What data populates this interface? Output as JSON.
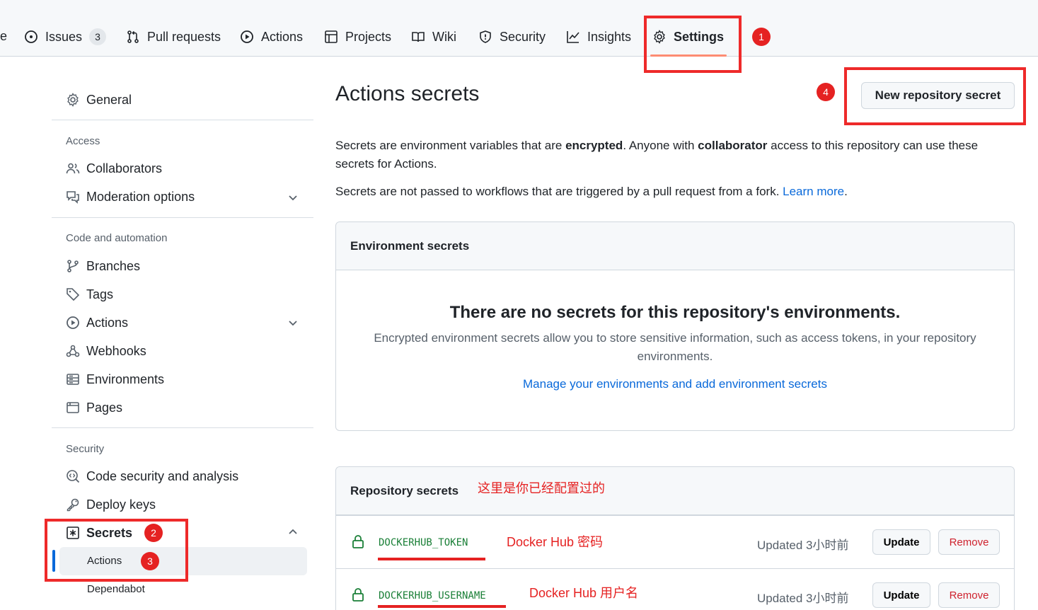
{
  "nav": {
    "truncated_left": "e",
    "tabs": [
      {
        "label": "Issues",
        "count": "3"
      },
      {
        "label": "Pull requests"
      },
      {
        "label": "Actions"
      },
      {
        "label": "Projects"
      },
      {
        "label": "Wiki"
      },
      {
        "label": "Security"
      },
      {
        "label": "Insights"
      },
      {
        "label": "Settings"
      }
    ]
  },
  "annotations": {
    "badges": [
      "1",
      "2",
      "3",
      "4"
    ],
    "notes": [
      "这里是你已经配置过的",
      "Docker Hub 密码",
      "Docker Hub 用户名"
    ]
  },
  "sidebar": {
    "general": "General",
    "sections": [
      {
        "heading": "Access",
        "items": [
          "Collaborators",
          "Moderation options"
        ]
      },
      {
        "heading": "Code and automation",
        "items": [
          "Branches",
          "Tags",
          "Actions",
          "Webhooks",
          "Environments",
          "Pages"
        ]
      },
      {
        "heading": "Security",
        "items": [
          "Code security and analysis",
          "Deploy keys",
          "Secrets"
        ]
      }
    ],
    "secrets_sub": [
      "Actions",
      "Dependabot"
    ]
  },
  "main": {
    "title": "Actions secrets",
    "new_secret_button": "New repository secret",
    "para1": {
      "a": "Secrets are environment variables that are ",
      "b": "encrypted",
      "c": ". Anyone with ",
      "d": "collaborator",
      "e": " access to this repository can use these secrets for Actions."
    },
    "para2": {
      "text": "Secrets are not passed to workflows that are triggered by a pull request from a fork. ",
      "link": "Learn more"
    },
    "env_box": {
      "header": "Environment secrets",
      "blank_title": "There are no secrets for this repository's environments.",
      "blank_desc": "Encrypted environment secrets allow you to store sensitive information, such as access tokens, in your repository environments.",
      "manage_link": "Manage your environments and add environment secrets"
    },
    "repo_box": {
      "header": "Repository secrets",
      "secrets": [
        {
          "name": "DOCKERHUB_TOKEN",
          "updated": "Updated 3小时前"
        },
        {
          "name": "DOCKERHUB_USERNAME",
          "updated": "Updated 3小时前"
        }
      ],
      "update_label": "Update",
      "remove_label": "Remove"
    }
  },
  "colors": {
    "accent": "#0969da",
    "annotation": "#e52222",
    "secret_name": "#1a7f37",
    "danger": "#cf222e"
  }
}
